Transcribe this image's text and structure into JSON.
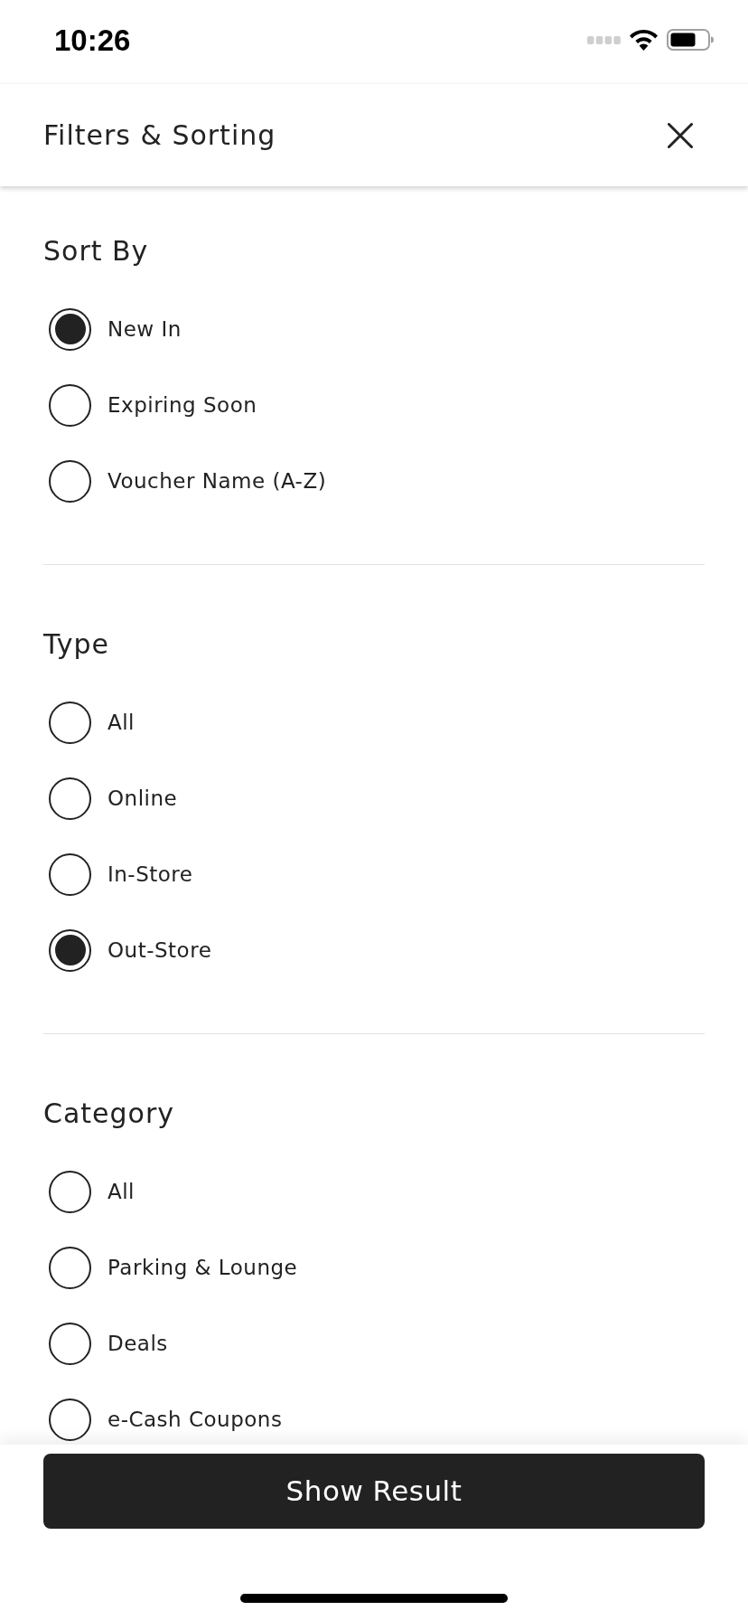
{
  "status_bar": {
    "time": "10:26"
  },
  "header": {
    "title": "Filters & Sorting"
  },
  "sections": [
    {
      "title": "Sort By",
      "options": [
        {
          "label": "New In",
          "selected": true
        },
        {
          "label": "Expiring Soon",
          "selected": false
        },
        {
          "label": "Voucher Name (A-Z)",
          "selected": false
        }
      ]
    },
    {
      "title": "Type",
      "options": [
        {
          "label": "All",
          "selected": false
        },
        {
          "label": "Online",
          "selected": false
        },
        {
          "label": "In-Store",
          "selected": false
        },
        {
          "label": "Out-Store",
          "selected": true
        }
      ]
    },
    {
      "title": "Category",
      "options": [
        {
          "label": "All",
          "selected": false
        },
        {
          "label": "Parking & Lounge",
          "selected": false
        },
        {
          "label": "Deals",
          "selected": false
        },
        {
          "label": "e-Cash Coupons",
          "selected": false
        }
      ]
    }
  ],
  "footer": {
    "button": "Show Result"
  }
}
